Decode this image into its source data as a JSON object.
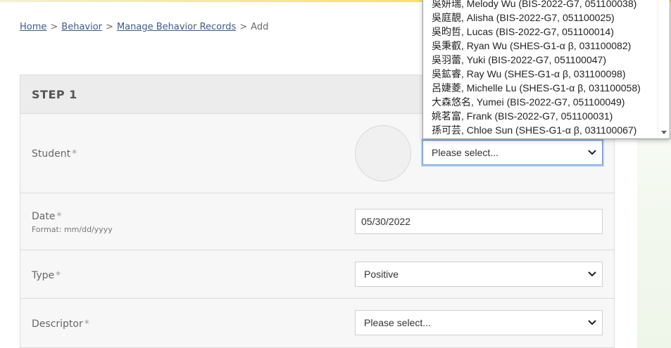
{
  "breadcrumb": {
    "home": "Home",
    "behavior": "Behavior",
    "manage": "Manage Behavior Records",
    "current": "Add",
    "separator": ">"
  },
  "step": {
    "title": "STEP 1"
  },
  "form": {
    "student": {
      "label": "Student",
      "required_mark": "*",
      "value": "Please select..."
    },
    "date": {
      "label": "Date",
      "required_mark": "*",
      "hint": "Format: mm/dd/yyyy",
      "value": "05/30/2022"
    },
    "type": {
      "label": "Type",
      "required_mark": "*",
      "value": "Positive"
    },
    "descriptor": {
      "label": "Descriptor",
      "required_mark": "*",
      "value": "Please select..."
    }
  },
  "student_options": [
    "吳妍瑞, Melody Wu (BIS-2022-G7, 051100038)",
    "吳庭靚, Alisha (BIS-2022-G7, 051100025)",
    "吳昀哲, Lucas (BIS-2022-G7, 051100014)",
    "吳秉叡, Ryan Wu (SHES-G1-α β, 031100082)",
    "吳羽蕾, Yuki (BIS-2022-G7, 051100047)",
    "吳鉱睿, Ray Wu (SHES-G1-α β, 031100098)",
    "呂婕菱, Michelle Lu (SHES-G1-α β, 031100058)",
    "大森悠名, Yumei (BIS-2022-G7, 051100049)",
    "姚茗富, Frank (BIS-2022-G7, 051100031)",
    "孫可芸, Chloe Sun (SHES-G1-α β, 031100067)"
  ],
  "colors": {
    "link": "#3d5a8a",
    "focus_border": "#5b8fd0",
    "header_bg": "#ececec",
    "card_bg": "#f7f7f7"
  }
}
